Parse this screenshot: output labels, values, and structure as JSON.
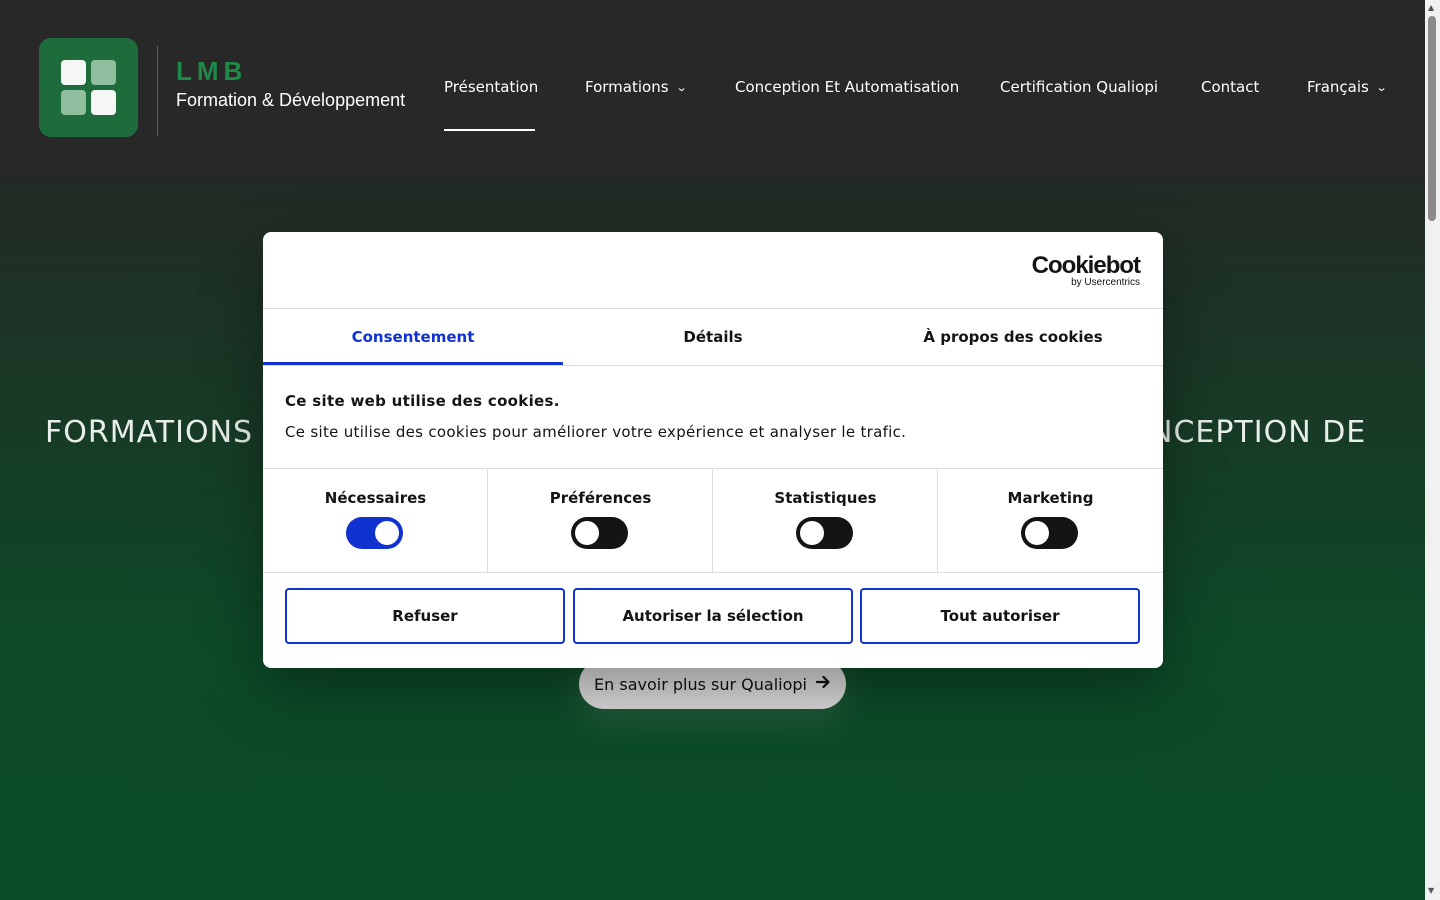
{
  "header": {
    "brand_name": "LMB",
    "brand_tagline": "Formation & Développement",
    "nav": [
      {
        "label": "Présentation"
      },
      {
        "label": "Formations"
      },
      {
        "label": "Conception Et Automatisation"
      },
      {
        "label": "Certification Qualiopi"
      },
      {
        "label": "Contact"
      },
      {
        "label": "Français"
      }
    ]
  },
  "hero": {
    "title_left": "FORMATIONS",
    "title_right": "NCEPTION DE",
    "cta_label": "En savoir plus sur Qualiopi"
  },
  "cookie_dialog": {
    "logo_main": "Cookiebot",
    "logo_sub": "by Usercentrics",
    "tabs": [
      {
        "label": "Consentement",
        "active": true
      },
      {
        "label": "Détails",
        "active": false
      },
      {
        "label": "À propos des cookies",
        "active": false
      }
    ],
    "heading": "Ce site web utilise des cookies.",
    "text": "Ce site utilise des cookies pour améliorer votre expérience et analyser le trafic.",
    "categories": [
      {
        "label": "Nécessaires",
        "enabled": true
      },
      {
        "label": "Préférences",
        "enabled": false
      },
      {
        "label": "Statistiques",
        "enabled": false
      },
      {
        "label": "Marketing",
        "enabled": false
      }
    ],
    "buttons": {
      "refuse": "Refuser",
      "allow_selection": "Autoriser la sélection",
      "allow_all": "Tout autoriser"
    }
  },
  "colors": {
    "accent_blue": "#1032cf",
    "brand_green": "#1e8a47",
    "header_bg": "#282828"
  },
  "icons": {
    "chevron": "chevron-down-icon",
    "arrow": "arrow-right-icon"
  }
}
